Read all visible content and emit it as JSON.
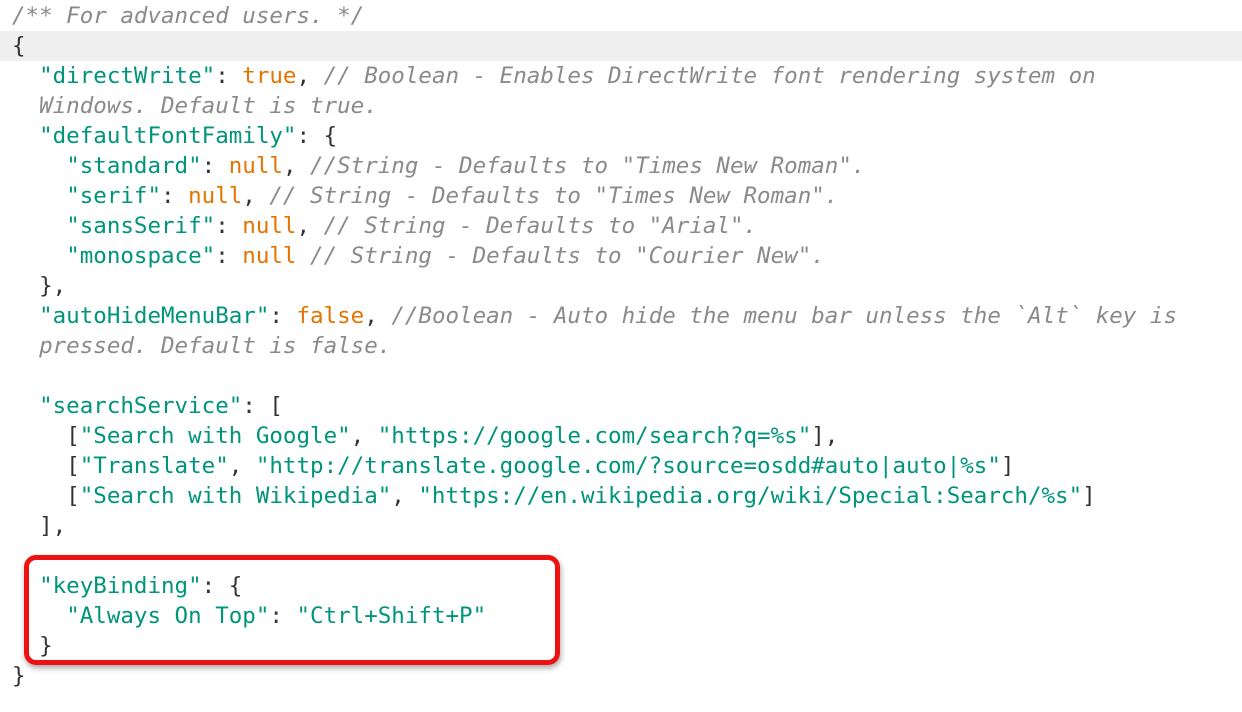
{
  "editor": {
    "lines": [
      {
        "indent": 0,
        "tokens": [
          {
            "t": "c",
            "v": "/** For advanced users. */"
          }
        ]
      },
      {
        "indent": 0,
        "current": true,
        "tokens": [
          {
            "t": "p",
            "v": "{"
          }
        ]
      },
      {
        "indent": 2,
        "tokens": [
          {
            "t": "k",
            "v": "\"directWrite\""
          },
          {
            "t": "p",
            "v": ": "
          },
          {
            "t": "lit",
            "v": "true"
          },
          {
            "t": "p",
            "v": ", "
          },
          {
            "t": "c",
            "v": "// Boolean - Enables DirectWrite font rendering system on"
          }
        ]
      },
      {
        "indent": 2,
        "tokens": [
          {
            "t": "c",
            "v": "Windows. Default is true."
          }
        ]
      },
      {
        "indent": 2,
        "tokens": [
          {
            "t": "k",
            "v": "\"defaultFontFamily\""
          },
          {
            "t": "p",
            "v": ": {"
          }
        ]
      },
      {
        "indent": 4,
        "tokens": [
          {
            "t": "k",
            "v": "\"standard\""
          },
          {
            "t": "p",
            "v": ": "
          },
          {
            "t": "lit",
            "v": "null"
          },
          {
            "t": "p",
            "v": ", "
          },
          {
            "t": "c",
            "v": "//String - Defaults to \"Times New Roman\"."
          }
        ]
      },
      {
        "indent": 4,
        "tokens": [
          {
            "t": "k",
            "v": "\"serif\""
          },
          {
            "t": "p",
            "v": ": "
          },
          {
            "t": "lit",
            "v": "null"
          },
          {
            "t": "p",
            "v": ", "
          },
          {
            "t": "c",
            "v": "// String - Defaults to \"Times New Roman\"."
          }
        ]
      },
      {
        "indent": 4,
        "tokens": [
          {
            "t": "k",
            "v": "\"sansSerif\""
          },
          {
            "t": "p",
            "v": ": "
          },
          {
            "t": "lit",
            "v": "null"
          },
          {
            "t": "p",
            "v": ", "
          },
          {
            "t": "c",
            "v": "// String - Defaults to \"Arial\"."
          }
        ]
      },
      {
        "indent": 4,
        "tokens": [
          {
            "t": "k",
            "v": "\"monospace\""
          },
          {
            "t": "p",
            "v": ": "
          },
          {
            "t": "lit",
            "v": "null"
          },
          {
            "t": "p",
            "v": " "
          },
          {
            "t": "c",
            "v": "// String - Defaults to \"Courier New\"."
          }
        ]
      },
      {
        "indent": 2,
        "tokens": [
          {
            "t": "p",
            "v": "},"
          }
        ]
      },
      {
        "indent": 2,
        "tokens": [
          {
            "t": "k",
            "v": "\"autoHideMenuBar\""
          },
          {
            "t": "p",
            "v": ": "
          },
          {
            "t": "lit",
            "v": "false"
          },
          {
            "t": "p",
            "v": ", "
          },
          {
            "t": "c",
            "v": "//Boolean - Auto hide the menu bar unless the `Alt` key is"
          }
        ]
      },
      {
        "indent": 2,
        "tokens": [
          {
            "t": "c",
            "v": "pressed. Default is false."
          }
        ]
      },
      {
        "indent": 0,
        "tokens": []
      },
      {
        "indent": 2,
        "tokens": [
          {
            "t": "k",
            "v": "\"searchService\""
          },
          {
            "t": "p",
            "v": ": ["
          }
        ]
      },
      {
        "indent": 4,
        "tokens": [
          {
            "t": "p",
            "v": "["
          },
          {
            "t": "s",
            "v": "\"Search with Google\""
          },
          {
            "t": "p",
            "v": ", "
          },
          {
            "t": "s",
            "v": "\"https://google.com/search?q=%s\""
          },
          {
            "t": "p",
            "v": "],"
          }
        ]
      },
      {
        "indent": 4,
        "tokens": [
          {
            "t": "p",
            "v": "["
          },
          {
            "t": "s",
            "v": "\"Translate\""
          },
          {
            "t": "p",
            "v": ", "
          },
          {
            "t": "s",
            "v": "\"http://translate.google.com/?source=osdd#auto|auto|%s\""
          },
          {
            "t": "p",
            "v": "]"
          }
        ]
      },
      {
        "indent": 4,
        "tokens": [
          {
            "t": "p",
            "v": "["
          },
          {
            "t": "s",
            "v": "\"Search with Wikipedia\""
          },
          {
            "t": "p",
            "v": ", "
          },
          {
            "t": "s",
            "v": "\"https://en.wikipedia.org/wiki/Special:Search/%s\""
          },
          {
            "t": "p",
            "v": "]"
          }
        ]
      },
      {
        "indent": 2,
        "tokens": [
          {
            "t": "p",
            "v": "],"
          }
        ]
      },
      {
        "indent": 0,
        "tokens": []
      },
      {
        "indent": 2,
        "tokens": [
          {
            "t": "k",
            "v": "\"keyBinding\""
          },
          {
            "t": "p",
            "v": ": {"
          }
        ]
      },
      {
        "indent": 4,
        "tokens": [
          {
            "t": "k",
            "v": "\"Always On Top\""
          },
          {
            "t": "p",
            "v": ": "
          },
          {
            "t": "s",
            "v": "\"Ctrl+Shift+P\""
          }
        ]
      },
      {
        "indent": 2,
        "tokens": [
          {
            "t": "p",
            "v": "}"
          }
        ]
      },
      {
        "indent": 0,
        "tokens": [
          {
            "t": "p",
            "v": "}"
          }
        ]
      }
    ]
  },
  "colors": {
    "key": "#00957b",
    "string": "#00957b",
    "comment": "#8a8a8a",
    "literal": "#e57300",
    "punctuation": "#333333",
    "current_line": "#efefef",
    "highlight_box": "#ee1111"
  }
}
